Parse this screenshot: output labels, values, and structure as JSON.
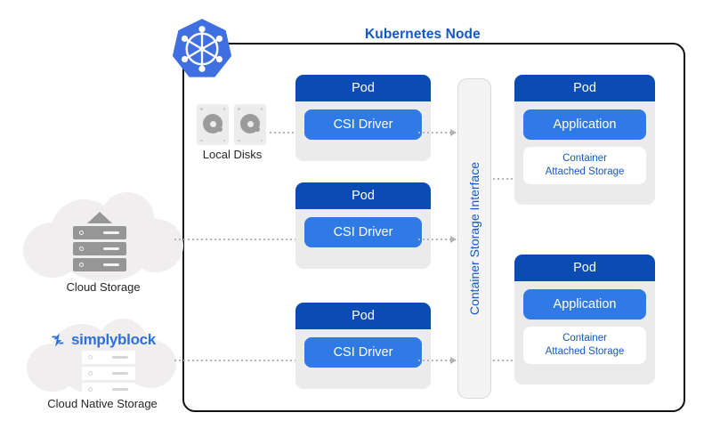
{
  "diagram": {
    "title": "Kubernetes Node",
    "node_border_color": "#111111",
    "title_color": "#1457c8"
  },
  "logos": {
    "kubernetes": "kubernetes-helm-logo",
    "simplyblock_mark": "simplyblock-logo-mark",
    "simplyblock_name": "simplyblock"
  },
  "csi": {
    "label": "Container Storage Interface"
  },
  "sources": [
    {
      "id": "local-disks",
      "label": "Local Disks",
      "icon": "hard-disk-icon"
    },
    {
      "id": "cloud-storage",
      "label": "Cloud Storage",
      "icon": "cloud-server-rack-icon"
    },
    {
      "id": "cloud-native-storage",
      "label": "Cloud Native Storage",
      "icon": "cloud-simplyblock-icon"
    }
  ],
  "driver_pods": [
    {
      "header": "Pod",
      "inner": "CSI Driver"
    },
    {
      "header": "Pod",
      "inner": "CSI Driver"
    },
    {
      "header": "Pod",
      "inner": "CSI Driver"
    }
  ],
  "app_pods": [
    {
      "header": "Pod",
      "application": "Application",
      "storage_line1": "Container",
      "storage_line2": "Attached Storage"
    },
    {
      "header": "Pod",
      "application": "Application",
      "storage_line1": "Container",
      "storage_line2": "Attached Storage"
    }
  ],
  "colors": {
    "pod_header": "#0b4cb4",
    "pod_body": "#ebebeb",
    "inner_blue": "#2f7ae5",
    "text_blue": "#1457c8",
    "arrow_gray": "#b4b4b4",
    "cloud_gray": "#f0eeee",
    "rack_gray": "#969696"
  }
}
